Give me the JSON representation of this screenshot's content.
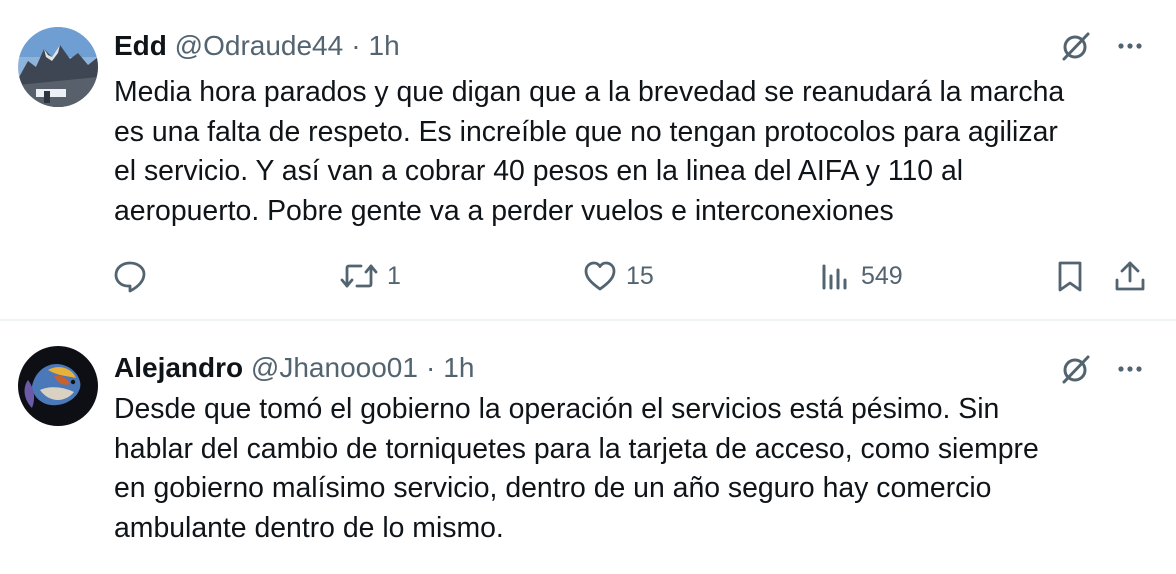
{
  "tweets": [
    {
      "name": "Edd",
      "handle": "@Odraude44",
      "separator": "·",
      "time": "1h",
      "text": "Media hora parados y que digan que a la brevedad se reanudará la marcha\nes una falta de respeto. Es increíble que no tengan protocolos para agilizar\nel servicio. Y así van a cobrar 40 pesos en la linea del AIFA y 110 al\naeropuerto. Pobre gente va a perder vuelos e interconexiones",
      "retweets": "1",
      "likes": "15",
      "views": "549",
      "avatar_icon": "mountain-photo-avatar"
    },
    {
      "name": "Alejandro",
      "handle": "@Jhanooo01",
      "separator": "·",
      "time": "1h",
      "text": "Desde que tomó el gobierno la operación el servicios está pésimo. Sin\nhablar del cambio de torniquetes para la tarjeta de acceso, como siempre\nen gobierno malísimo servicio, dentro de un año seguro hay comercio\nambulante dentro de lo mismo.",
      "avatar_icon": "betta-fish-avatar"
    }
  ],
  "icons": {
    "grok": "grok-icon",
    "more": "more-icon",
    "reply": "reply-icon",
    "retweet": "retweet-icon",
    "like": "heart-icon",
    "views": "views-icon",
    "bookmark": "bookmark-icon",
    "share": "share-icon"
  },
  "colors": {
    "text": "#0f1419",
    "secondary": "#536471",
    "divider": "#eff3f4",
    "background": "#ffffff"
  }
}
